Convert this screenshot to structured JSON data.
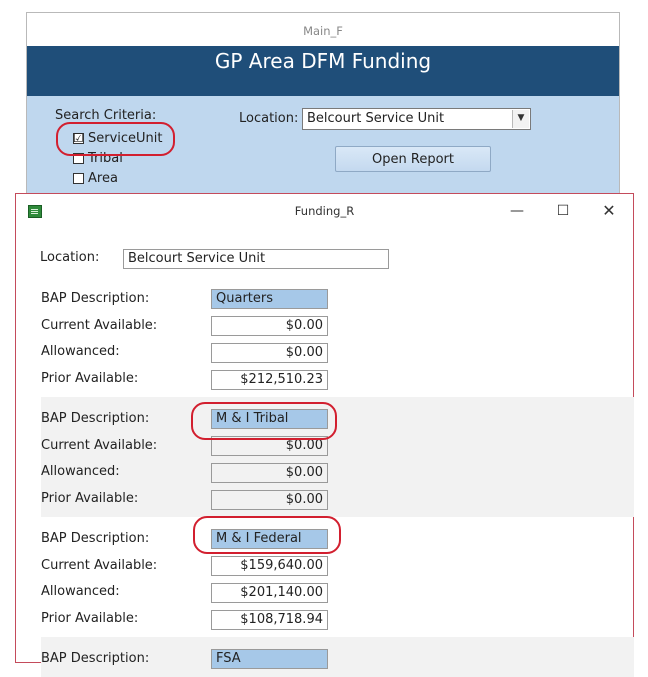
{
  "main_form": {
    "window_title": "Main_F",
    "header_title": "GP Area DFM Funding",
    "search_criteria_label": "Search Criteria:",
    "checkboxes": [
      {
        "label": "ServiceUnit",
        "checked": "☑"
      },
      {
        "label": "Tribal",
        "checked": ""
      },
      {
        "label": "Area",
        "checked": ""
      }
    ],
    "location_label": "Location:",
    "location_value": "Belcourt Service Unit",
    "open_report_label": "Open Report"
  },
  "report": {
    "window_title": "Funding_R",
    "controls": {
      "minimize": "—",
      "maximize": "☐",
      "close": "✕"
    },
    "location_label": "Location:",
    "location_value": "Belcourt Service Unit",
    "field_labels": {
      "bap_description": "BAP Description:",
      "current_available": "Current Available:",
      "allowanced": "Allowanced:",
      "prior_available": "Prior Available:"
    },
    "records": [
      {
        "bap_description": "Quarters",
        "current_available": "$0.00",
        "allowanced": "$0.00",
        "prior_available": "$212,510.23"
      },
      {
        "bap_description": "M & I Tribal",
        "current_available": "$0.00",
        "allowanced": "$0.00",
        "prior_available": "$0.00"
      },
      {
        "bap_description": "M & I Federal",
        "current_available": "$159,640.00",
        "allowanced": "$201,140.00",
        "prior_available": "$108,718.94"
      },
      {
        "bap_description": "FSA"
      }
    ]
  },
  "colors": {
    "header_blue": "#1f4e79",
    "form_body_blue": "#bfd7ee",
    "desc_field_blue": "#a6c8e8",
    "annotation_red": "#d21f2f"
  }
}
